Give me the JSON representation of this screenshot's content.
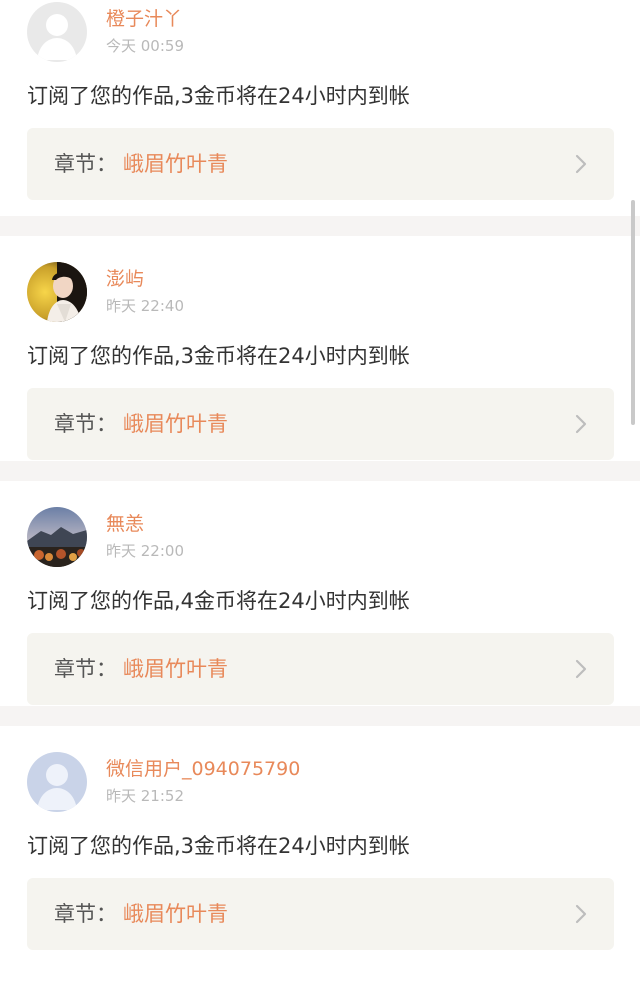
{
  "notifications": [
    {
      "username": "橙子汁丫",
      "time": "今天 00:59",
      "message": "订阅了您的作品,3金币将在24小时内到帐",
      "chapter_label": "章节：",
      "chapter_title": "峨眉竹叶青",
      "avatar": "default-gray-avatar"
    },
    {
      "username": "澎屿",
      "time": "昨天 22:40",
      "message": "订阅了您的作品,3金币将在24小时内到帐",
      "chapter_label": "章节：",
      "chapter_title": "峨眉竹叶青",
      "avatar": "portrait-photo-avatar"
    },
    {
      "username": "無恙",
      "time": "昨天 22:00",
      "message": "订阅了您的作品,4金币将在24小时内到帐",
      "chapter_label": "章节：",
      "chapter_title": "峨眉竹叶青",
      "avatar": "landscape-photo-avatar"
    },
    {
      "username": "微信用户_094075790",
      "time": "昨天 21:52",
      "message": "订阅了您的作品,3金币将在24小时内到帐",
      "chapter_label": "章节：",
      "chapter_title": "峨眉竹叶青",
      "avatar": "default-blue-avatar"
    }
  ],
  "colors": {
    "accent": "#e8895a",
    "text": "#333333",
    "muted": "#b9b9b9",
    "chapter_bg": "#f5f4ef",
    "divider": "#f6f4f3"
  }
}
